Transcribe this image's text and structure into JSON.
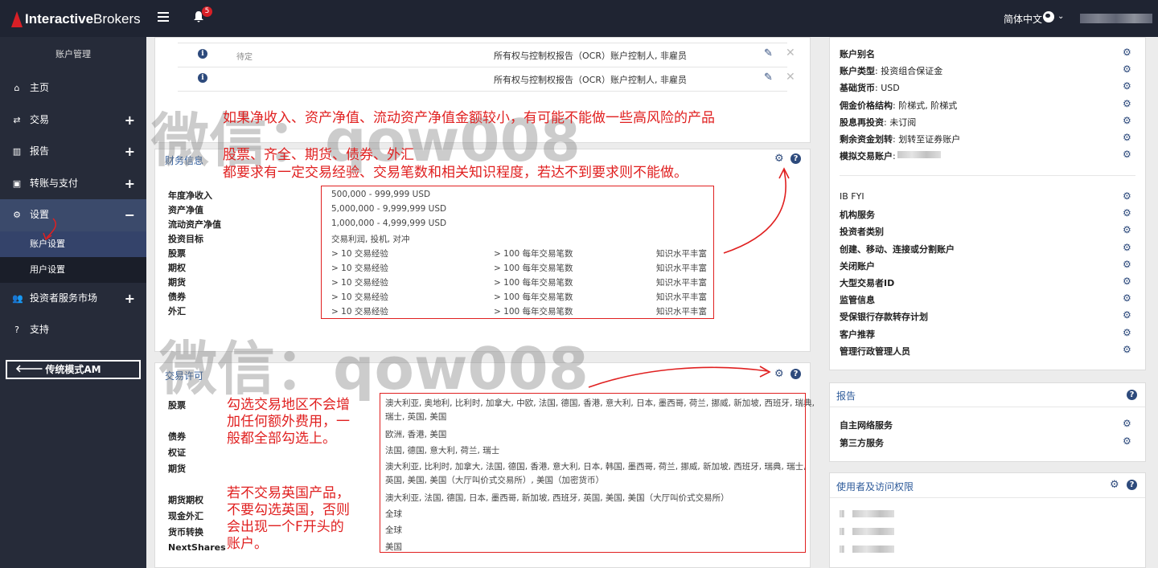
{
  "topbar": {
    "brand_bold": "Interactive",
    "brand_rest": "Brokers",
    "notification_count": "5",
    "language": "简体中文"
  },
  "sidebar": {
    "title": "账户管理",
    "items": [
      {
        "label": "主页",
        "icon": "home-icon",
        "glyph": "⌂",
        "plus": ""
      },
      {
        "label": "交易",
        "icon": "exchange-icon",
        "glyph": "⇄",
        "plus": "+"
      },
      {
        "label": "报告",
        "icon": "bar-chart-icon",
        "glyph": "▥",
        "plus": "+"
      },
      {
        "label": "转账与支付",
        "icon": "money-icon",
        "glyph": "▣",
        "plus": "+"
      },
      {
        "label": "设置",
        "icon": "gears-icon",
        "glyph": "⚙",
        "plus": "−"
      }
    ],
    "sub_items": [
      "账户设置",
      "用户设置"
    ],
    "items_after": [
      {
        "label": "投资者服务市场",
        "icon": "users-icon",
        "glyph": "👥",
        "plus": "+"
      },
      {
        "label": "支持",
        "icon": "help-icon",
        "glyph": "?",
        "plus": ""
      }
    ],
    "legacy_button": "传统模式AM"
  },
  "ocr_rows": [
    {
      "status": "待定",
      "text": "所有权与控制权报告（OCR）账户控制人, 非雇员"
    },
    {
      "status": "",
      "text": "所有权与控制权报告（OCR）账户控制人, 非雇员"
    }
  ],
  "annotations": {
    "note1": "如果净收入、资产净值、流动资产净值金额较小，有可能不能做一些高风险的产品",
    "note2_line1": "股票、齐全、期货、债券、外汇",
    "note2_line2": "都要求有一定交易经验、交易笔数和相关知识程度，若达不到要求则不能做。",
    "note3": "勾选交易地区不会增加任何额外费用，一般都全部勾选上。",
    "note4": "若不交易英国产品，不要勾选英国，否则会出现一个F开头的账户。",
    "watermark": "微信：qow008"
  },
  "financial": {
    "title": "财务信息",
    "rows": [
      {
        "label": "年度净收入",
        "v1": "500,000 - 999,999 USD",
        "v2": "",
        "v3": ""
      },
      {
        "label": "资产净值",
        "v1": "5,000,000 - 9,999,999 USD",
        "v2": "",
        "v3": ""
      },
      {
        "label": "流动资产净值",
        "v1": "1,000,000 - 4,999,999 USD",
        "v2": "",
        "v3": ""
      },
      {
        "label": "投资目标",
        "v1": "交易利润, 投机, 对冲",
        "v2": "",
        "v3": ""
      },
      {
        "label": "股票",
        "v1": "> 10 交易经验",
        "v2": "> 100 每年交易笔数",
        "v3": "知识水平丰富"
      },
      {
        "label": "期权",
        "v1": "> 10 交易经验",
        "v2": "> 100 每年交易笔数",
        "v3": "知识水平丰富"
      },
      {
        "label": "期货",
        "v1": "> 10 交易经验",
        "v2": "> 100 每年交易笔数",
        "v3": "知识水平丰富"
      },
      {
        "label": "债券",
        "v1": "> 10 交易经验",
        "v2": "> 100 每年交易笔数",
        "v3": "知识水平丰富"
      },
      {
        "label": "外汇",
        "v1": "> 10 交易经验",
        "v2": "> 100 每年交易笔数",
        "v3": "知识水平丰富"
      }
    ]
  },
  "permissions": {
    "title": "交易许可",
    "rows": [
      {
        "label": "股票",
        "value": "澳大利亚, 奥地利, 比利时, 加拿大, 中欧, 法国, 德国, 香港, 意大利, 日本, 墨西哥, 荷兰, 挪威, 新加坡, 西班牙, 瑞典,",
        "value2": "瑞士, 英国, 美国"
      },
      {
        "label": "债券",
        "value": "欧洲, 香港, 美国",
        "value2": ""
      },
      {
        "label": "权证",
        "value": "法国, 德国, 意大利, 荷兰, 瑞士",
        "value2": ""
      },
      {
        "label": "期货",
        "value": "澳大利亚, 比利时, 加拿大, 法国, 德国, 香港, 意大利, 日本, 韩国, 墨西哥, 荷兰, 挪威, 新加坡, 西班牙, 瑞典, 瑞士,",
        "value2": "英国, 美国, 美国（大厅叫价式交易所）, 美国（加密货币）"
      },
      {
        "label": "期货期权",
        "value": "澳大利亚, 法国, 德国, 日本, 墨西哥, 新加坡, 西班牙, 英国, 美国, 美国（大厅叫价式交易所）",
        "value2": ""
      },
      {
        "label": "现金外汇",
        "value": "全球",
        "value2": ""
      },
      {
        "label": "货币转换",
        "value": "全球",
        "value2": ""
      },
      {
        "label": "NextShares",
        "value": "美国",
        "value2": ""
      }
    ]
  },
  "right_config": {
    "items": [
      {
        "label": "账户别名",
        "value": ""
      },
      {
        "label": "账户类型",
        "value": ": 投资组合保证金"
      },
      {
        "label": "基础货币",
        "value": ": USD"
      },
      {
        "label": "佣金价格结构",
        "value": ": 阶梯式, 阶梯式"
      },
      {
        "label": "股息再投资",
        "value": ": 未订阅"
      },
      {
        "label": "剩余资金划转",
        "value": ": 划转至证券账户"
      },
      {
        "label": "模拟交易账户",
        "value": ":"
      }
    ],
    "items2": [
      "IB FYI",
      "机构服务",
      "投资者类别",
      "创建、移动、连接或分割账户",
      "关闭账户",
      "大型交易者ID",
      "监管信息",
      "受保银行存款转存计划",
      "客户推荐",
      "管理行政管理人员"
    ]
  },
  "reports": {
    "title": "报告",
    "items": [
      "自主网络服务",
      "第三方服务"
    ]
  },
  "users_access": {
    "title": "使用者及访问权限"
  },
  "colors": {
    "nav_bg": "#262b39",
    "topbar_bg": "#1f2432",
    "accent": "#2d4a7c",
    "annotation_red": "#e02020"
  }
}
